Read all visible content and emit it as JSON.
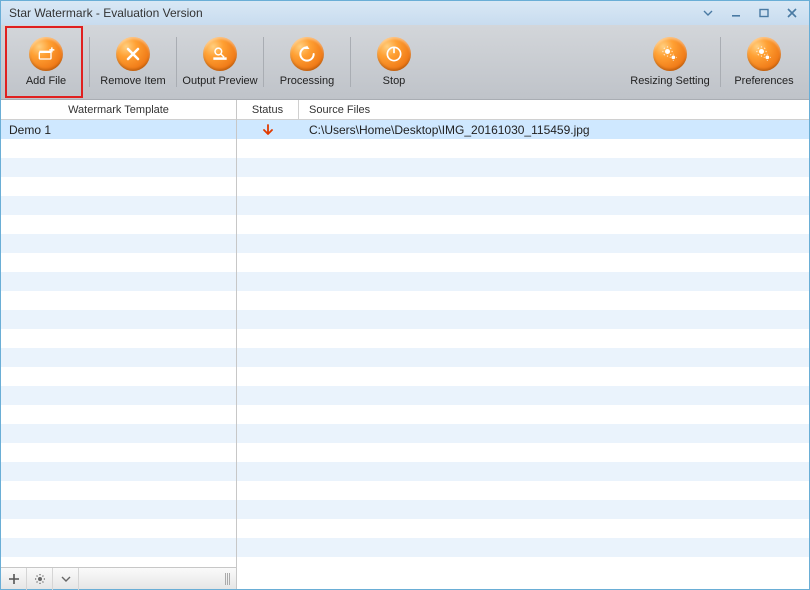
{
  "window": {
    "title": "Star Watermark - Evaluation Version"
  },
  "toolbar": {
    "add_file": "Add File",
    "remove_item": "Remove Item",
    "output_preview": "Output Preview",
    "processing": "Processing",
    "stop": "Stop",
    "resizing_setting": "Resizing Setting",
    "preferences": "Preferences"
  },
  "left_header": "Watermark Template",
  "right_header": {
    "status": "Status",
    "source": "Source Files"
  },
  "templates": [
    {
      "name": "Demo 1",
      "selected": true
    }
  ],
  "files": [
    {
      "status": "down-arrow",
      "path": "C:\\Users\\Home\\Desktop\\IMG_20161030_115459.jpg",
      "selected": true
    }
  ],
  "colors": {
    "accent": "#f07b18",
    "selection": "#cfe8ff",
    "stripe": "#eaf3fc"
  }
}
